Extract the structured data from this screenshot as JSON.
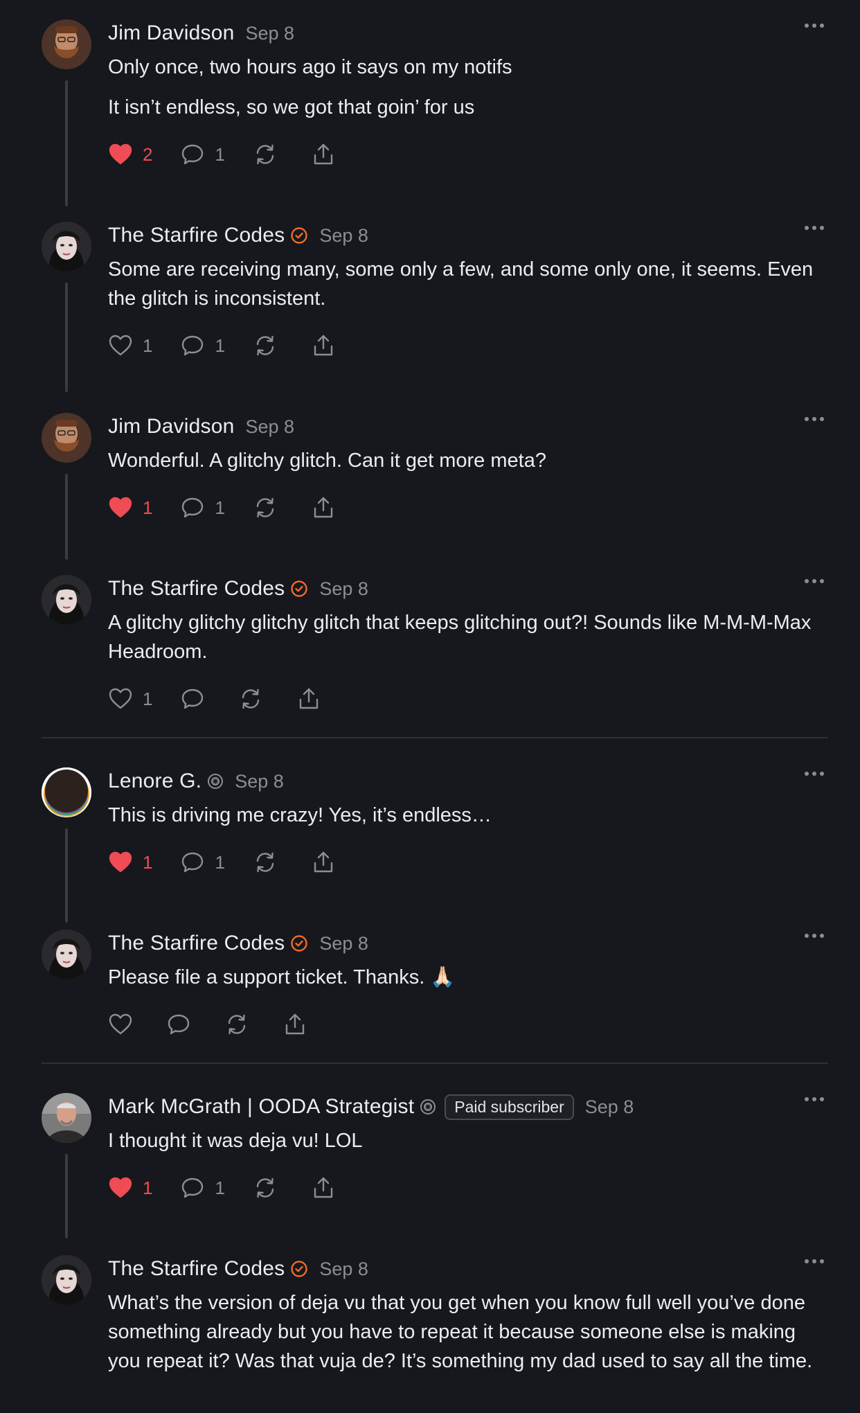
{
  "colors": {
    "background": "#16181d",
    "like": "#ef4c55",
    "verified": "#f26a2b",
    "muted": "#8c8e94"
  },
  "comments": [
    {
      "author": "Jim Davidson",
      "date": "Sep 8",
      "text": [
        "Only once, two hours ago it says on my notifs",
        "It isn’t endless, so we got that goin’ for us"
      ],
      "likes": "2",
      "liked": true,
      "replies": "1"
    },
    {
      "author": "The Starfire Codes",
      "date": "Sep 8",
      "verified": true,
      "text": [
        "Some are receiving many, some only a few, and some only one, it seems. Even the glitch is inconsistent."
      ],
      "likes": "1",
      "liked": false,
      "replies": "1"
    },
    {
      "author": "Jim Davidson",
      "date": "Sep 8",
      "text": [
        "Wonderful. A glitchy glitch. Can it get more meta?"
      ],
      "likes": "1",
      "liked": true,
      "replies": "1"
    },
    {
      "author": "The Starfire Codes",
      "date": "Sep 8",
      "verified": true,
      "text": [
        "A glitchy glitchy glitchy glitch that keeps glitching out?! Sounds like M-M-M-Max Headroom."
      ],
      "likes": "1",
      "liked": false,
      "replies": ""
    },
    {
      "author": "Lenore G.",
      "date": "Sep 8",
      "subscriber_icon": true,
      "text": [
        "This is driving me crazy! Yes, it’s endless…"
      ],
      "likes": "1",
      "liked": true,
      "replies": "1"
    },
    {
      "author": "The Starfire Codes",
      "date": "Sep 8",
      "verified": true,
      "text": [
        "Please file a support ticket. Thanks. 🙏🏻"
      ],
      "likes": "",
      "liked": false,
      "replies": ""
    },
    {
      "author": "Mark McGrath | OODA Strategist",
      "date": "Sep 8",
      "subscriber_icon": true,
      "paid_badge": "Paid subscriber",
      "text": [
        "I thought it was deja vu! LOL"
      ],
      "likes": "1",
      "liked": true,
      "replies": "1"
    },
    {
      "author": "The Starfire Codes",
      "date": "Sep 8",
      "verified": true,
      "text": [
        "What’s the version of deja vu that you get when you know full well you’ve done something already but you have to repeat it because someone else is making you repeat it? Was that vuja de? It’s something my dad used to say all the time."
      ]
    }
  ]
}
